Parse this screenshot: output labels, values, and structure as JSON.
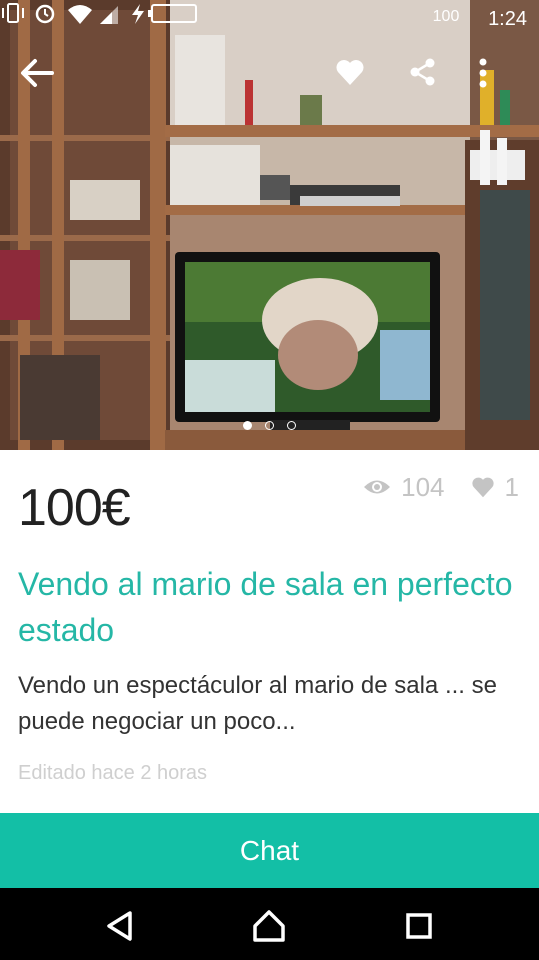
{
  "status_bar": {
    "battery": "100",
    "time": "1:24",
    "icons": [
      "vibrate-icon",
      "alarm-icon",
      "wifi-icon",
      "signal-icon",
      "charging-icon",
      "battery-icon"
    ]
  },
  "top_bar": {
    "icons": [
      "back-arrow-icon",
      "heart-icon",
      "share-icon",
      "more-vert-icon"
    ]
  },
  "gallery": {
    "image_count": 3,
    "active_index": 0
  },
  "listing": {
    "price": "100€",
    "views": "104",
    "likes": "1",
    "title": "Vendo al mario de sala en perfecto estado",
    "description": "Vendo un espectáculor  al mario  de sala  ... se puede negociar  un poco...",
    "edited": "Editado hace 2 horas"
  },
  "actions": {
    "chat_label": "Chat"
  },
  "colors": {
    "accent": "#25b7a6",
    "chat_button": "#13bfa6",
    "stats": "#c4c4c4"
  },
  "navigation": {
    "icons": [
      "back-triangle-icon",
      "home-icon",
      "recents-icon"
    ]
  }
}
